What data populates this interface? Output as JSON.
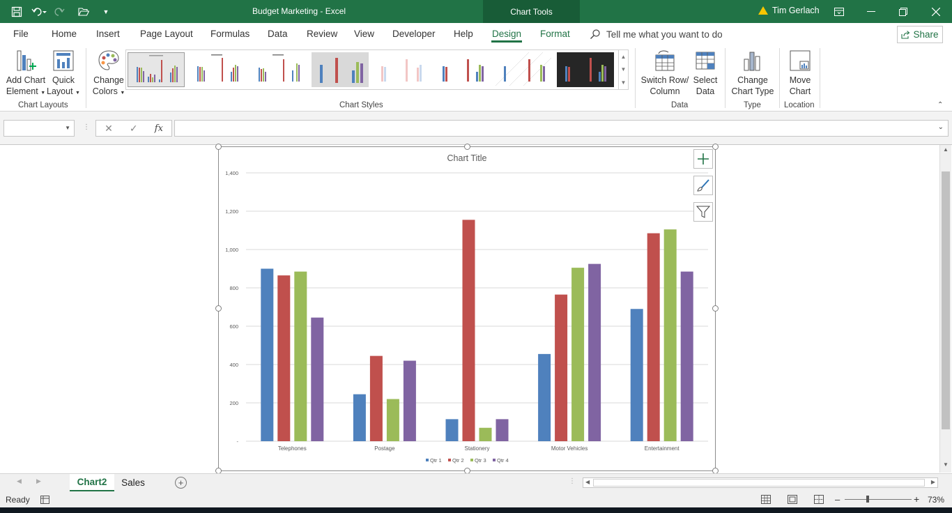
{
  "window": {
    "doc_title": "Budget Marketing  -  Excel",
    "context_label": "Chart Tools",
    "user_name": "Tim Gerlach"
  },
  "tabs": [
    "File",
    "Home",
    "Insert",
    "Page Layout",
    "Formulas",
    "Data",
    "Review",
    "View",
    "Developer",
    "Help",
    "Design",
    "Format"
  ],
  "active_tab": "Design",
  "tellme": "Tell me what you want to do",
  "share_label": "Share",
  "ribbon": {
    "add_chart_element": [
      "Add Chart",
      "Element"
    ],
    "quick_layout": [
      "Quick",
      "Layout"
    ],
    "change_colors": [
      "Change",
      "Colors"
    ],
    "chart_layouts_group": "Chart Layouts",
    "chart_styles_group": "Chart Styles",
    "switch_row_col": [
      "Switch Row/",
      "Column"
    ],
    "select_data": [
      "Select",
      "Data"
    ],
    "data_group": "Data",
    "change_chart_type": [
      "Change",
      "Chart Type"
    ],
    "type_group": "Type",
    "move_chart": [
      "Move",
      "Chart"
    ],
    "location_group": "Location"
  },
  "formula_bar": {
    "name_box": "",
    "formula": ""
  },
  "sheets": [
    "Chart2",
    "Sales"
  ],
  "active_sheet": "Chart2",
  "status": {
    "ready": "Ready",
    "zoom": "73%"
  },
  "colors": {
    "accent": "#217346",
    "qtr1": "#4f81bd",
    "qtr2": "#c0504d",
    "qtr3": "#9bbb59",
    "qtr4": "#8064a2"
  },
  "chart_data": {
    "type": "bar",
    "title": "Chart Title",
    "categories": [
      "Telephones",
      "Postage",
      "Stationery",
      "Motor Vehicles",
      "Entertainment"
    ],
    "series": [
      {
        "name": "Qtr 1",
        "values": [
          900,
          245,
          115,
          455,
          690
        ]
      },
      {
        "name": "Qtr 2",
        "values": [
          865,
          445,
          1155,
          765,
          1085
        ]
      },
      {
        "name": "Qtr 3",
        "values": [
          885,
          220,
          70,
          905,
          1105
        ]
      },
      {
        "name": "Qtr 4",
        "values": [
          645,
          420,
          115,
          925,
          885
        ]
      }
    ],
    "yticks": [
      "-",
      "200",
      "400",
      "600",
      "800",
      "1,000",
      "1,200",
      "1,400"
    ],
    "ylim": [
      0,
      1400
    ],
    "grid": true,
    "legend": "bottom"
  }
}
